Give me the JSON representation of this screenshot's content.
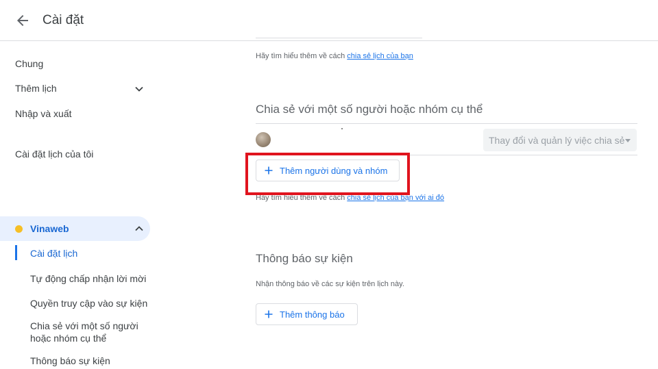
{
  "header": {
    "back_icon": "arrow-back-icon",
    "title": "Cài đặt"
  },
  "sidebar": {
    "items": [
      {
        "label": "Chung"
      },
      {
        "label": "Thêm lịch",
        "icon": "chevron-down-icon"
      },
      {
        "label": "Nhập và xuất"
      }
    ],
    "my_calendars_heading": "Cài đặt lịch của tôi",
    "calendar": {
      "name": "Vinaweb",
      "color": "#f6bf26",
      "icon": "chevron-up-icon",
      "subitems": [
        {
          "label": "Cài đặt lịch",
          "active": true
        },
        {
          "label": "Tự động chấp nhận lời mời"
        },
        {
          "label": "Quyền truy cập vào sự kiện"
        },
        {
          "label": "Chia sẻ với một số người hoặc nhóm cụ thể"
        },
        {
          "label": "Thông báo sự kiện"
        }
      ]
    }
  },
  "main": {
    "help_top": {
      "prefix": "Hãy tìm hiểu thêm về cách ",
      "link": "chia sẻ lịch của bạn"
    },
    "share_section": {
      "title": "Chia sẻ với một số người hoặc nhóm cụ thể",
      "permission_placeholder": "Thay đổi và quản lý việc chia sẻ",
      "add_button": "Thêm người dùng và nhóm",
      "help": {
        "prefix": "Hãy tìm hiểu thêm về cách ",
        "link": "chia sẻ lịch của bạn với ai đó"
      }
    },
    "notify_section": {
      "title": "Thông báo sự kiện",
      "description": "Nhận thông báo về các sự kiện trên lịch này.",
      "add_button": "Thêm thông báo"
    }
  },
  "colors": {
    "accent": "#1a73e8",
    "highlight_box": "#e0141e",
    "active_bg": "#e8f0fe"
  }
}
